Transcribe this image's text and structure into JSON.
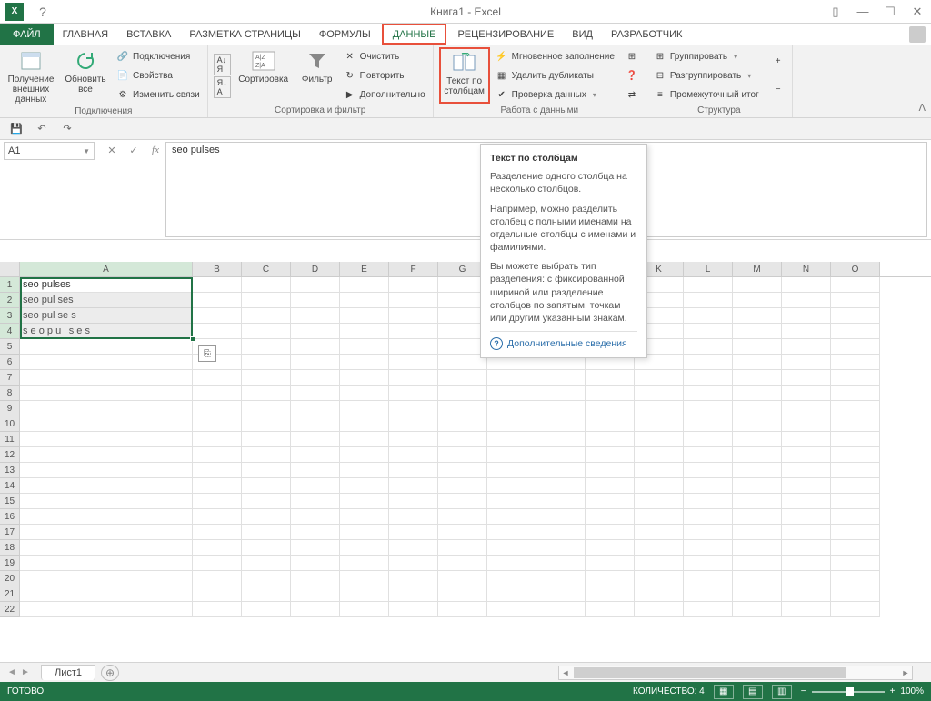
{
  "title": "Книга1 - Excel",
  "tabs": {
    "file": "ФАЙЛ",
    "items": [
      "ГЛАВНАЯ",
      "ВСТАВКА",
      "РАЗМЕТКА СТРАНИЦЫ",
      "ФОРМУЛЫ",
      "ДАННЫЕ",
      "РЕЦЕНЗИРОВАНИЕ",
      "ВИД",
      "РАЗРАБОТЧИК"
    ],
    "active_index": 4
  },
  "ribbon": {
    "groups": {
      "conn": {
        "label": "Подключения",
        "getdata": "Получение\nвнешних\nданных",
        "refresh": "Обновить\nвсе",
        "items": [
          "Подключения",
          "Свойства",
          "Изменить связи"
        ]
      },
      "sort": {
        "label": "Сортировка и фильтр",
        "sort": "Сортировка",
        "filter": "Фильтр",
        "items": [
          "Очистить",
          "Повторить",
          "Дополнительно"
        ]
      },
      "datawork": {
        "label": "Работа с данными",
        "textcol": "Текст по\nстолбцам",
        "items": [
          "Мгновенное заполнение",
          "Удалить дубликаты",
          "Проверка данных"
        ]
      },
      "struct": {
        "label": "Структура",
        "items": [
          "Группировать",
          "Разгруппировать",
          "Промежуточный итог"
        ]
      }
    }
  },
  "namebox": "A1",
  "formula": "seo pulses",
  "tooltip": {
    "title": "Текст по столбцам",
    "p1": "Разделение одного столбца на несколько столбцов.",
    "p2": "Например, можно разделить столбец с полными именами на отдельные столбцы с именами и фамилиями.",
    "p3": "Вы можете выбрать тип разделения: с фиксированной шириной или разделение столбцов по запятым, точкам или другим указанным знакам.",
    "more": "Дополнительные сведения"
  },
  "columns": [
    "A",
    "B",
    "C",
    "D",
    "E",
    "F",
    "G",
    "H",
    "I",
    "J",
    "K",
    "L",
    "M",
    "N",
    "O"
  ],
  "rows": 22,
  "cells": {
    "A1": "seo pulses",
    "A2": "seo pul ses",
    "A3": "seo pul se s",
    "A4": "s e o p u l s e s"
  },
  "sheet": "Лист1",
  "status": {
    "ready": "ГОТОВО",
    "count_label": "КОЛИЧЕСТВО: 4",
    "zoom": "100%"
  }
}
